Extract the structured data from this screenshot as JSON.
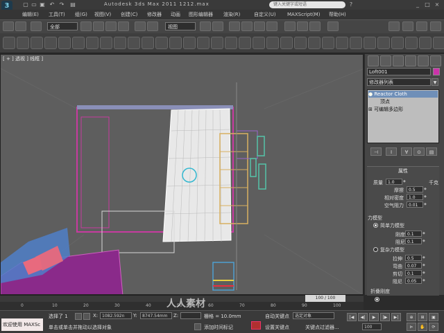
{
  "window": {
    "app_logo": "3",
    "title": "Autodesk 3ds Max 2011    1212.max",
    "search_placeholder": "键入关键字或短语",
    "help_icon": "?",
    "min": "_",
    "max": "□",
    "close": "×"
  },
  "menu": [
    "编辑(E)",
    "工具(T)",
    "组(G)",
    "视图(V)",
    "创建(C)",
    "修改器",
    "动画",
    "图形编辑器",
    "渲染(R)",
    "自定义(U)",
    "MAXScript(M)",
    "帮助(H)"
  ],
  "toolbar": {
    "selection_filter": "全部",
    "ref_coord": "视图",
    "icons": [
      "undo-icon",
      "redo-icon",
      "select-link-icon",
      "unlink-icon",
      "bind-spacewarp-icon",
      "select-icon",
      "select-by-name-icon",
      "rect-select-icon",
      "window-crossing-icon",
      "move-icon",
      "rotate-icon",
      "scale-icon",
      "pivot-icon",
      "mirror-icon",
      "align-icon",
      "layer-icon",
      "curve-editor-icon",
      "schematic-icon",
      "material-editor-icon",
      "render-setup-icon",
      "render-frame-icon",
      "render-icon"
    ]
  },
  "viewport": {
    "label": "[ + ] 透视 ] 线框 ]"
  },
  "command_panel": {
    "object_name": "Loft001",
    "object_color": "#cc33aa",
    "modifier_list": "修改器列表",
    "stack": [
      "Reactor Cloth",
      "顶点",
      "可编辑多边形"
    ],
    "rollout_title": "属性",
    "properties": [
      {
        "label": "质量",
        "value": "1.0",
        "unit": "千克"
      },
      {
        "label": "摩擦",
        "value": "0.5"
      },
      {
        "label": "相对密度",
        "value": "1.0"
      },
      {
        "label": "空气阻力",
        "value": "0.01"
      }
    ],
    "force_model_title": "力模型",
    "simple_force": "简单力模型",
    "simple_props": [
      {
        "label": "刚度",
        "value": "0.1"
      },
      {
        "label": "阻尼",
        "value": "0.1"
      }
    ],
    "complex_force": "复杂力模型",
    "complex_props": [
      {
        "label": "拉伸",
        "value": "0.5"
      },
      {
        "label": "弯曲",
        "value": "0.07"
      },
      {
        "label": "剪切",
        "value": "0.1"
      },
      {
        "label": "阻尼",
        "value": "0.05"
      }
    ],
    "fold_title": "折叠刚度",
    "fold_none": "无"
  },
  "timeline": {
    "current": "100 / 100",
    "ticks": [
      "0",
      "10",
      "20",
      "30",
      "40",
      "50",
      "60",
      "70",
      "80",
      "90",
      "100"
    ]
  },
  "status": {
    "listener": "欢迎使用 MAXSc",
    "selected": "选择了 1",
    "prompt": "单击或单击并拖动以选择对象",
    "x": "1082.592n",
    "y": "8747.54mm",
    "z": "",
    "grid": "栅格 = 10.0mm",
    "add_time_tag": "添加时间标记",
    "auto_key": "自动关键点",
    "set_key": "设置关键点",
    "selected_obj": "选定对象",
    "key_filter": "关键点过滤器...",
    "frame": "100"
  },
  "watermark": "人人素材"
}
